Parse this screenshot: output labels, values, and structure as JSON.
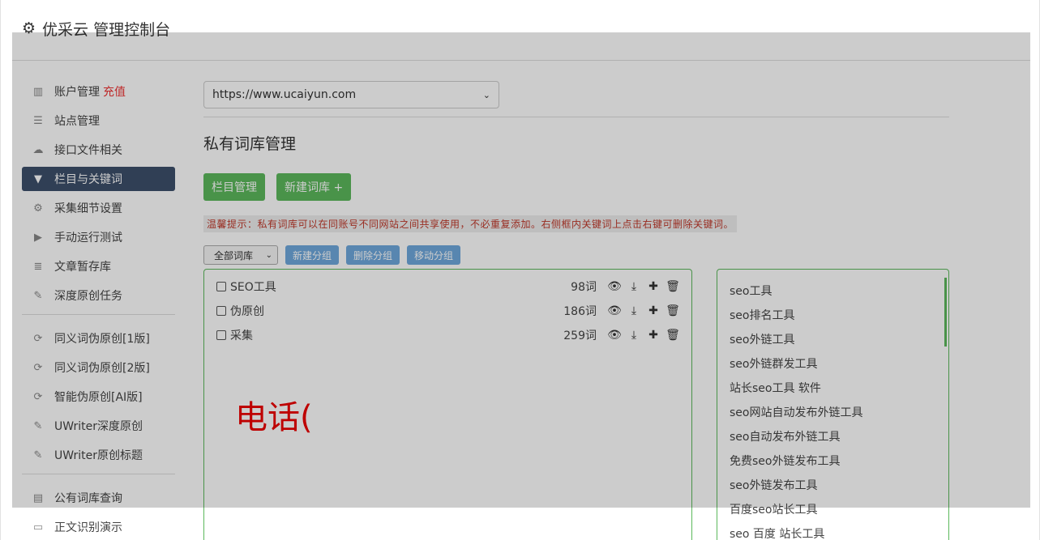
{
  "header": {
    "title": "优采云 管理控制台",
    "icon": "gear-icon"
  },
  "sidebar": {
    "groups": [
      [
        {
          "label": "账户管理",
          "badge": "充值",
          "icon": "bar-chart-icon"
        },
        {
          "label": "站点管理",
          "icon": "server-icon"
        },
        {
          "label": "接口文件相关",
          "icon": "cloud-upload-icon"
        },
        {
          "label": "栏目与关键词",
          "icon": "filter-icon",
          "active": true
        },
        {
          "label": "采集细节设置",
          "icon": "cogs-icon"
        },
        {
          "label": "手动运行测试",
          "icon": "play-circle-icon"
        },
        {
          "label": "文章暂存库",
          "icon": "database-icon"
        },
        {
          "label": "深度原创任务",
          "icon": "edit-icon"
        }
      ],
      [
        {
          "label": "同义词伪原创[1版]",
          "icon": "refresh-icon"
        },
        {
          "label": "同义词伪原创[2版]",
          "icon": "refresh-icon"
        },
        {
          "label": "智能伪原创[AI版]",
          "icon": "refresh-icon"
        },
        {
          "label": "UWriter深度原创",
          "icon": "edit-icon"
        },
        {
          "label": "UWriter原创标题",
          "icon": "edit-icon"
        }
      ],
      [
        {
          "label": "公有词库查询",
          "icon": "book-icon"
        },
        {
          "label": "正文识别演示",
          "icon": "monitor-icon"
        }
      ]
    ]
  },
  "main": {
    "site_select": "https://www.ucaiyun.com",
    "title": "私有词库管理",
    "btn_category": "栏目管理",
    "btn_new_lib": "新建词库 +",
    "tip": "温馨提示：私有词库可以在同账号不同网站之间共享使用，不必重复添加。右侧框内关键词上点击右键可删除关键词。",
    "group_select": "全部词库",
    "btn_new_group": "新建分组",
    "btn_delete_group": "删除分组",
    "btn_move_group": "移动分组",
    "libraries": [
      {
        "name": "SEO工具",
        "count": "98词"
      },
      {
        "name": "伪原创",
        "count": "186词"
      },
      {
        "name": "采集",
        "count": "259词"
      }
    ],
    "overlay_text": "电话(",
    "keywords": [
      "seo工具",
      "seo排名工具",
      "seo外链工具",
      "seo外链群发工具",
      "站长seo工具 软件",
      "seo网站自动发布外链工具",
      "seo自动发布外链工具",
      "免费seo外链发布工具",
      "seo外链发布工具",
      "百度seo站长工具",
      "seo 百度 站长工具"
    ]
  },
  "colors": {
    "active_nav": "#3d4f6b",
    "green": "#5cb85c",
    "blue": "#6fa8dc",
    "warning": "#c0392b",
    "red": "#e00"
  }
}
